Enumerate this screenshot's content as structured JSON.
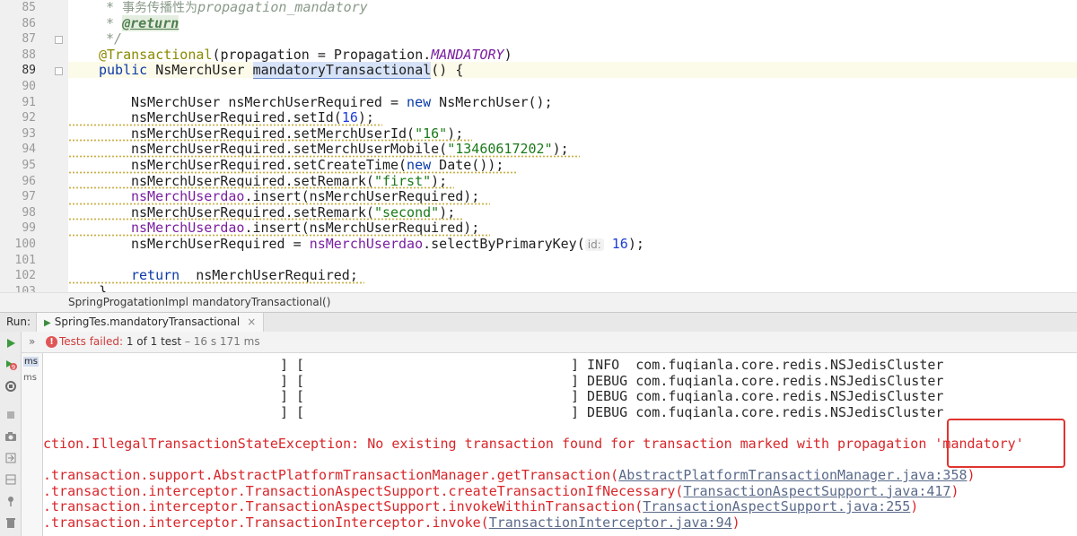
{
  "editor": {
    "line_numbers": [
      "85",
      "86",
      "87",
      "88",
      "89",
      "90",
      "91",
      "92",
      "93",
      "94",
      "95",
      "96",
      "97",
      "98",
      "99",
      "100",
      "101",
      "102",
      "103"
    ],
    "code": {
      "l85_prefix": "* ",
      "l85_cn": "事务传播性为",
      "l85_it": "propagation_mandatory",
      "l86_prefix": "* ",
      "l86_tag": "@return",
      "l87": "*/",
      "l88_ann": "@Transactional",
      "l88_open": "(propagation = Propagation.",
      "l88_const": "MANDATORY",
      "l88_close": ")",
      "l89_kw": "public ",
      "l89_type": "NsMerchUser ",
      "l89_method": "mandatoryTransactional",
      "l89_rest": "() {",
      "l91_a": "NsMerchUser nsMerchUserRequired = ",
      "l91_kw": "new",
      "l91_b": " NsMerchUser();",
      "l92_a": "nsMerchUserRequired.setId(",
      "l92_num": "16",
      "l92_b": ");",
      "l93_a": "nsMerchUserRequired.setMerchUserId(",
      "l93_str": "\"16\"",
      "l93_b": ");",
      "l94_a": "nsMerchUserRequired.setMerchUserMobile(",
      "l94_str": "\"13460617202\"",
      "l94_b": ");",
      "l95_a": "nsMerchUserRequired.setCreateTime(",
      "l95_kw": "new",
      "l95_b": " Date());",
      "l96_a": "nsMerchUserRequired.setRemark(",
      "l96_str": "\"first\"",
      "l96_b": ");",
      "l97_field": "nsMerchUserdao",
      "l97_b": ".insert(nsMerchUserRequired);",
      "l98_a": "nsMerchUserRequired.setRemark(",
      "l98_str": "\"second\"",
      "l98_b": ");",
      "l99_field": "nsMerchUserdao",
      "l99_b": ".insert(nsMerchUserRequired);",
      "l100_a": "nsMerchUserRequired = ",
      "l100_field": "nsMerchUserdao",
      "l100_b": ".selectByPrimaryKey(",
      "l100_hint": "id:",
      "l100_num": "16",
      "l100_c": ");",
      "l102_kw": "return",
      "l102_b": "  nsMerchUserRequired;",
      "l103": "}"
    }
  },
  "breadcrumb": {
    "class_name": "SpringProgatationImpl",
    "separator": "›",
    "method_name": "mandatoryTransactional()"
  },
  "run_window": {
    "label": "Run:",
    "tab_icon": "▶",
    "tab_title": "SpringTes.mandatoryTransactional",
    "tab_close": "×",
    "status_chevrons": "»",
    "status_failed": "Tests failed: ",
    "status_count": "1 of 1 test",
    "status_time": " – 16 s 171 ms",
    "tree_items": [
      "ms",
      "ms"
    ]
  },
  "console": {
    "log_lines": [
      {
        "prefix": "] [",
        "level": "] INFO  com.fuqianla.core.redis.NSJedisCluster"
      },
      {
        "prefix": "] [",
        "level": "] DEBUG com.fuqianla.core.redis.NSJedisCluster"
      },
      {
        "prefix": "] [",
        "level": "] DEBUG com.fuqianla.core.redis.NSJedisCluster"
      },
      {
        "prefix": "] [",
        "level": "] DEBUG com.fuqianla.core.redis.NSJedisCluster"
      }
    ],
    "exception": "ction.IllegalTransactionStateException: No existing transaction found for transaction marked with propagation 'mandatory'",
    "stack": [
      {
        "text": ".transaction.support.AbstractPlatformTransactionManager.getTransaction(",
        "link": "AbstractPlatformTransactionManager.java:358",
        "end": ")"
      },
      {
        "text": ".transaction.interceptor.TransactionAspectSupport.createTransactionIfNecessary(",
        "link": "TransactionAspectSupport.java:417",
        "end": ")"
      },
      {
        "text": ".transaction.interceptor.TransactionAspectSupport.invokeWithinTransaction(",
        "link": "TransactionAspectSupport.java:255",
        "end": ")"
      },
      {
        "text": ".transaction.interceptor.TransactionInterceptor.invoke(",
        "link": "TransactionInterceptor.java:94",
        "end": ")"
      }
    ]
  },
  "colors": {
    "error_red": "#d8262a",
    "highlight_box": "#e0342f",
    "keyword_blue": "#0b3aa8",
    "string_green": "#1a7a1a",
    "field_purple": "#7a1fa0"
  }
}
